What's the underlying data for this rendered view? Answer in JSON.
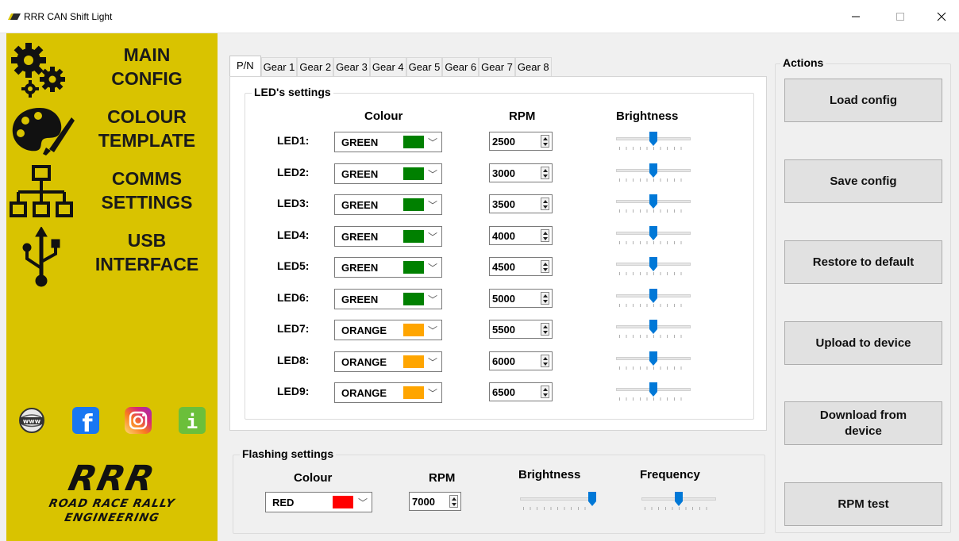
{
  "window": {
    "title": "RRR CAN Shift Light",
    "min_glyph": "—",
    "max_glyph": "☐",
    "close_glyph": "✕"
  },
  "sidebar": {
    "items": [
      {
        "line1": "MAIN",
        "line2": "CONFIG",
        "icon": "gears-icon"
      },
      {
        "line1": "COLOUR",
        "line2": "TEMPLATE",
        "icon": "palette-icon"
      },
      {
        "line1": "COMMS",
        "line2": "SETTINGS",
        "icon": "network-icon"
      },
      {
        "line1": "USB",
        "line2": "INTERFACE",
        "icon": "usb-icon"
      }
    ],
    "social": [
      {
        "icon": "www-globe-icon",
        "text": "www"
      },
      {
        "icon": "facebook-icon",
        "text": "f"
      },
      {
        "icon": "instagram-icon",
        "text": ""
      },
      {
        "icon": "info-icon",
        "text": "i"
      }
    ],
    "brand": {
      "logo": "RRR",
      "line1": "ROAD RACE RALLY",
      "line2": "ENGINEERING"
    }
  },
  "tabs": [
    "P/N",
    "Gear 1",
    "Gear 2",
    "Gear 3",
    "Gear 4",
    "Gear 5",
    "Gear 6",
    "Gear 7",
    "Gear 8"
  ],
  "led_settings": {
    "title": "LED's settings",
    "col_colour": "Colour",
    "col_rpm": "RPM",
    "col_brightness": "Brightness",
    "leds": [
      {
        "label": "LED1:",
        "colour": "GREEN",
        "swatch": "#008000",
        "rpm": "2500",
        "brightness": 0.5
      },
      {
        "label": "LED2:",
        "colour": "GREEN",
        "swatch": "#008000",
        "rpm": "3000",
        "brightness": 0.5
      },
      {
        "label": "LED3:",
        "colour": "GREEN",
        "swatch": "#008000",
        "rpm": "3500",
        "brightness": 0.5
      },
      {
        "label": "LED4:",
        "colour": "GREEN",
        "swatch": "#008000",
        "rpm": "4000",
        "brightness": 0.5
      },
      {
        "label": "LED5:",
        "colour": "GREEN",
        "swatch": "#008000",
        "rpm": "4500",
        "brightness": 0.5
      },
      {
        "label": "LED6:",
        "colour": "GREEN",
        "swatch": "#008000",
        "rpm": "5000",
        "brightness": 0.5
      },
      {
        "label": "LED7:",
        "colour": "ORANGE",
        "swatch": "#ffa500",
        "rpm": "5500",
        "brightness": 0.5
      },
      {
        "label": "LED8:",
        "colour": "ORANGE",
        "swatch": "#ffa500",
        "rpm": "6000",
        "brightness": 0.5
      },
      {
        "label": "LED9:",
        "colour": "ORANGE",
        "swatch": "#ffa500",
        "rpm": "6500",
        "brightness": 0.5
      }
    ]
  },
  "flashing": {
    "title": "Flashing settings",
    "col_colour": "Colour",
    "col_rpm": "RPM",
    "col_brightness": "Brightness",
    "col_frequency": "Frequency",
    "colour": "RED",
    "swatch": "#ff0000",
    "rpm": "7000",
    "brightness": 1.0,
    "frequency": 0.5
  },
  "actions": {
    "title": "Actions",
    "buttons": [
      "Load config",
      "Save config",
      "Restore to default",
      "Upload to device",
      "Download from device",
      "RPM test"
    ]
  },
  "colors": {
    "sidebar": "#d9c300",
    "slider_thumb": "#0078d7"
  }
}
